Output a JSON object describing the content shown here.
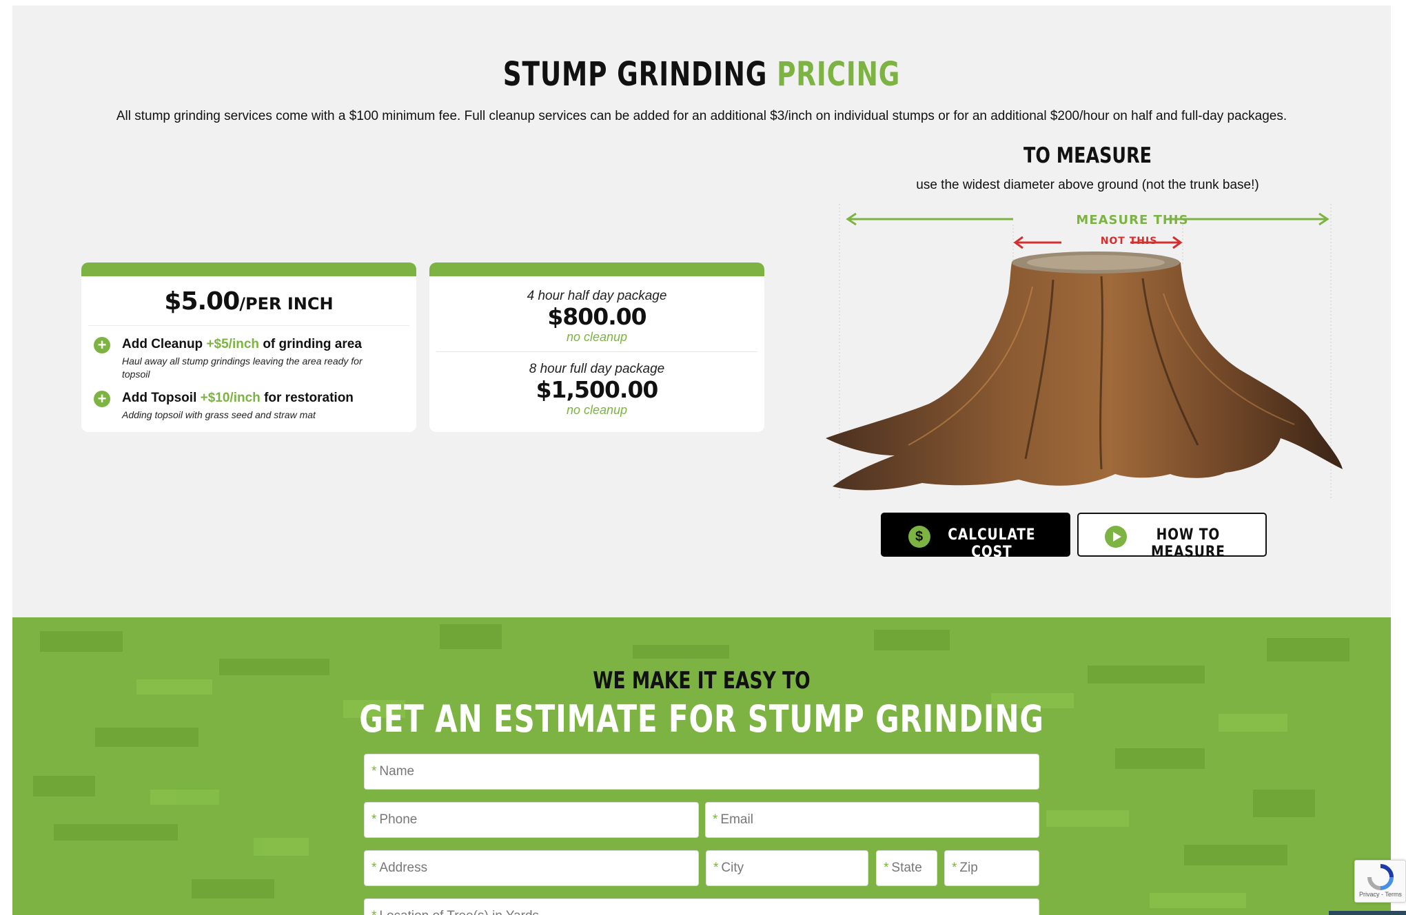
{
  "pricing": {
    "title_main": "STUMP GRINDING",
    "title_accent": "PRICING",
    "subtitle": "All stump grinding services come with a $100 minimum fee. Full cleanup services can be added for an additional $3/inch on individual stumps or for an additional $200/hour on half and full-day packages."
  },
  "per_inch_card": {
    "price": "$5.00",
    "unit": "/PER INCH",
    "addons": [
      {
        "prefix": "Add Cleanup",
        "price": "+$5/inch",
        "suffix": "of grinding area",
        "description": "Haul away all stump grindings leaving the area ready for topsoil"
      },
      {
        "prefix": "Add Topsoil",
        "price": "+$10/inch",
        "suffix": "for restoration",
        "description": "Adding topsoil with grass seed and straw mat"
      }
    ]
  },
  "packages_card": {
    "packages": [
      {
        "label": "4 hour half day package",
        "price": "$800.00",
        "note": "no cleanup"
      },
      {
        "label": "8 hour full day package",
        "price": "$1,500.00",
        "note": "no cleanup"
      }
    ]
  },
  "measure": {
    "title": "TO MEASURE",
    "subtitle": "use the widest diameter above ground (not the trunk base!)",
    "measure_this": "MEASURE THIS",
    "not_this": "NOT THIS"
  },
  "buttons": {
    "calculate": "CALCULATE COST",
    "calculate_icon_glyph": "$",
    "how_to": "HOW TO MEASURE"
  },
  "estimate": {
    "eyebrow": "WE MAKE IT EASY TO",
    "title": "GET AN ESTIMATE FOR STUMP GRINDING",
    "required_marker": "*",
    "fields": {
      "name": "Name",
      "phone": "Phone",
      "email": "Email",
      "address": "Address",
      "city": "City",
      "state": "State",
      "zip": "Zip",
      "location": "Location of Tree(s) in Yards"
    }
  },
  "recaptcha": {
    "footer": "Privacy - Terms"
  },
  "colors": {
    "accent_green": "#7cb342",
    "red": "#d32f2f",
    "dark": "#111111",
    "panel_bg": "#f1f1f1"
  },
  "icons": [
    "plus-circle-icon",
    "dollar-circle-icon",
    "play-circle-icon",
    "recaptcha-icon",
    "left-arrow-icon",
    "right-arrow-icon"
  ]
}
